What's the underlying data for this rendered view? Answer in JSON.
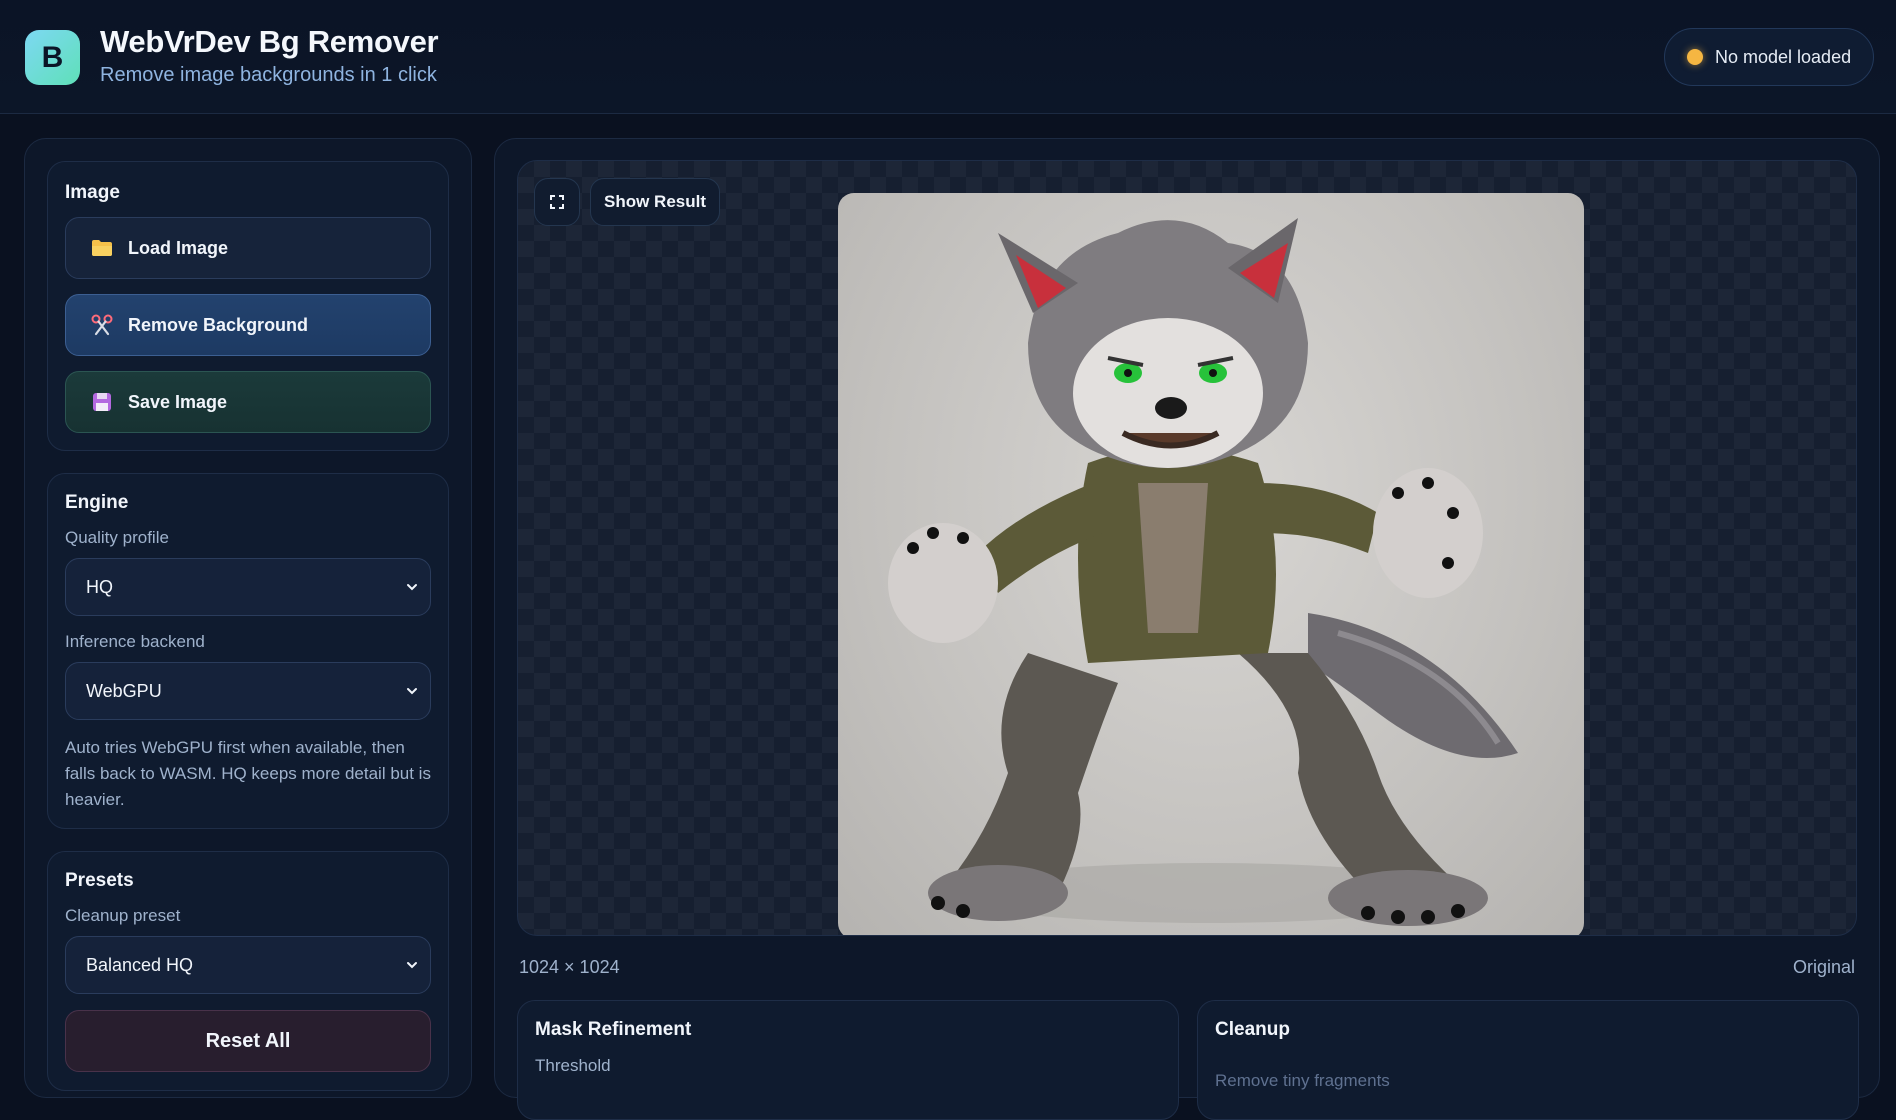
{
  "header": {
    "logo_letter": "B",
    "title": "WebVrDev Bg Remover",
    "subtitle": "Remove image backgrounds in 1 click",
    "status": "No model loaded",
    "status_color": "#f5b642"
  },
  "sidebar": {
    "image_card": {
      "title": "Image",
      "load_label": "Load Image",
      "load_icon": "folder-icon",
      "remove_label": "Remove Background",
      "remove_icon": "scissors-icon",
      "save_label": "Save Image",
      "save_icon": "floppy-disk-icon"
    },
    "engine_card": {
      "title": "Engine",
      "quality_label": "Quality profile",
      "quality_value": "HQ",
      "backend_label": "Inference backend",
      "backend_value": "WebGPU",
      "help": "Auto tries WebGPU first when available, then falls back to WASM. HQ keeps more detail but is heavier."
    },
    "presets_card": {
      "title": "Presets",
      "preset_label": "Cleanup preset",
      "preset_value": "Balanced HQ",
      "reset_label": "Reset All"
    }
  },
  "main": {
    "show_result_label": "Show Result",
    "fullscreen_icon": "fullscreen-icon",
    "image_subject": "werewolf-character-image",
    "dimensions": "1024 × 1024",
    "view_mode": "Original",
    "mask_panel": {
      "title": "Mask Refinement",
      "first_label": "Threshold"
    },
    "cleanup_panel": {
      "title": "Cleanup",
      "first_label": "Remove tiny fragments"
    }
  },
  "colors": {
    "accent_blue": "#23426e",
    "accent_green": "#1b3a3a",
    "background": "#0a1120"
  }
}
